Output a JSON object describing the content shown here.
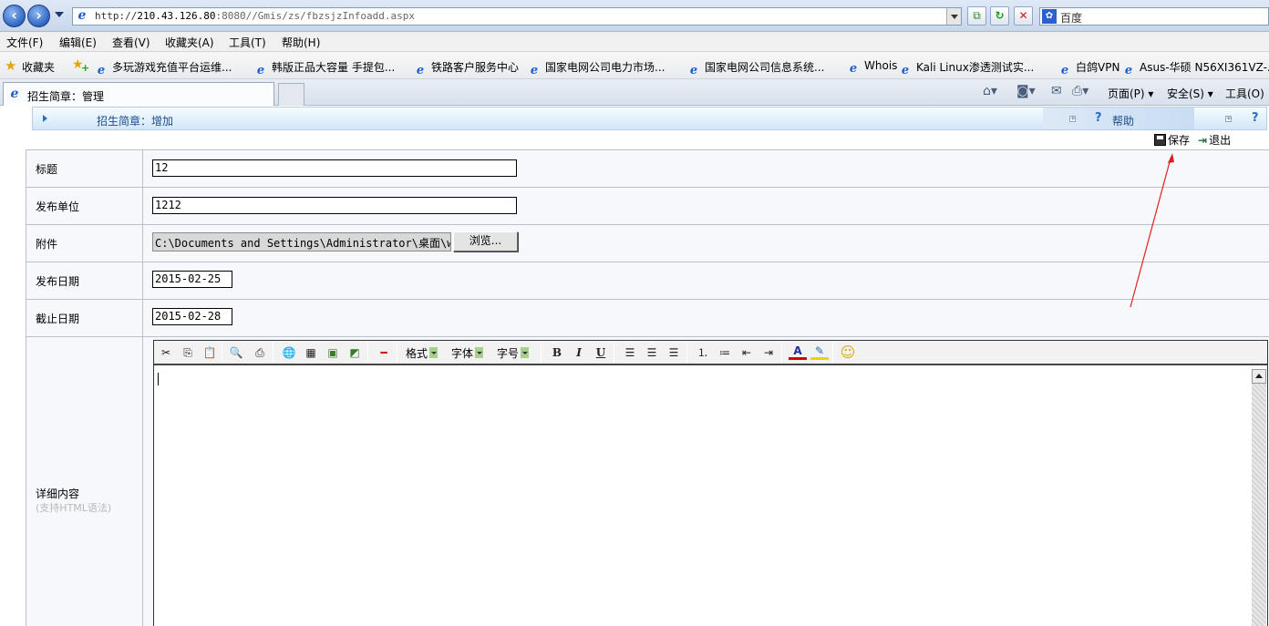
{
  "browser": {
    "address": {
      "scheme": "http://",
      "host": "210.43.126.80",
      "rest": ":8080//Gmis/zs/fbzsjzInfoadd.aspx"
    },
    "search_placeholder": "百度",
    "menu": [
      "文件(F)",
      "编辑(E)",
      "查看(V)",
      "收藏夹(A)",
      "工具(T)",
      "帮助(H)"
    ],
    "favorites_label": "收藏夹",
    "favorites": [
      "多玩游戏充值平台运维...",
      "韩版正品大容量 手提包...",
      "铁路客户服务中心",
      "国家电网公司电力市场...",
      "国家电网公司信息系统...",
      "Whois",
      "Kali Linux渗透测试实...",
      "白鸽VPN",
      "Asus-华硕 N56XI361VZ-..."
    ],
    "tab_title": "招生简章：管理",
    "commands": {
      "page": "页面(P)",
      "safety": "安全(S)",
      "tools": "工具(O)"
    }
  },
  "page": {
    "header_title": "招生简章：增加",
    "help_label": "帮助",
    "save_label": "保存",
    "exit_label": "退出"
  },
  "form": {
    "title_label": "标题",
    "title_value": "12",
    "unit_label": "发布单位",
    "unit_value": "1212",
    "attach_label": "附件",
    "attach_value": "C:\\Documents and Settings\\Administrator\\桌面\\wc",
    "browse_label": "浏览...",
    "pubdate_label": "发布日期",
    "pubdate_value": "2015-02-25",
    "enddate_label": "截止日期",
    "enddate_value": "2015-02-28",
    "content_label": "详细内容",
    "content_hint": "(支持HTML语法)"
  },
  "editor": {
    "format_label": "格式",
    "font_label": "字体",
    "size_label": "字号"
  },
  "colors": {
    "annotation": "#e02020",
    "header_text": "#1b4d8c"
  }
}
